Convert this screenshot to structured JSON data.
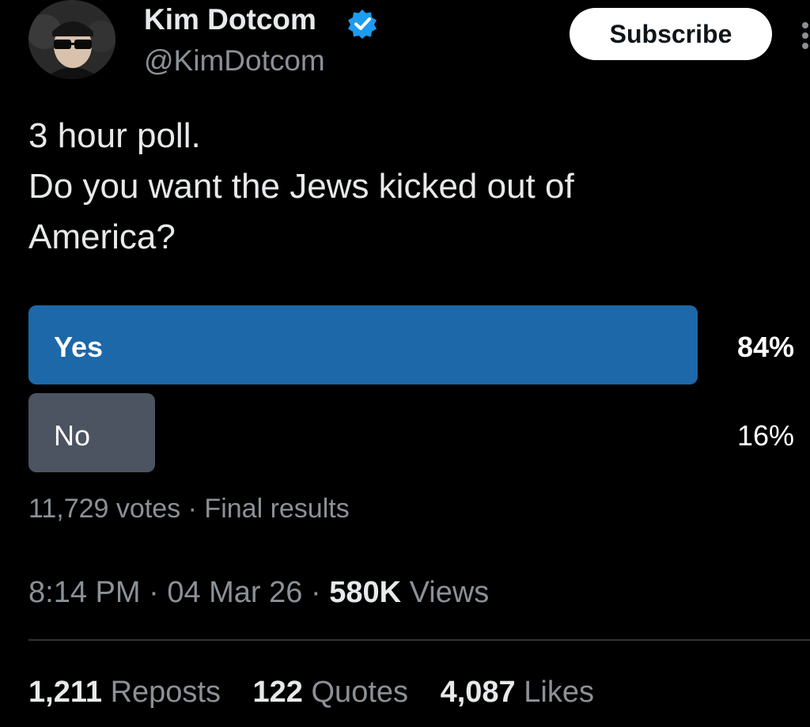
{
  "author": {
    "name": "Kim Dotcom",
    "handle": "@KimDotcom",
    "verified": true
  },
  "subscribe_label": "Subscribe",
  "tweet": {
    "lines": [
      "3 hour poll.",
      "Do you want the Jews kicked out of",
      "America?"
    ]
  },
  "poll": {
    "options": [
      {
        "label": "Yes",
        "percent_text": "84%",
        "percent": 84,
        "leading": true
      },
      {
        "label": "No",
        "percent_text": "16%",
        "percent": 16,
        "leading": false
      }
    ],
    "votes": "11,729 votes",
    "separator": "·",
    "status": "Final results"
  },
  "meta": {
    "time": "8:14 PM",
    "separator": "·",
    "date": "04 Mar 26",
    "views_count": "580K",
    "views_label": "Views"
  },
  "stats": {
    "reposts_count": "1,211",
    "reposts_label": "Reposts",
    "quotes_count": "122",
    "quotes_label": "Quotes",
    "likes_count": "4,087",
    "likes_label": "Likes"
  },
  "colors": {
    "background": "#000000",
    "text": "#e7e9ea",
    "secondary_text": "#8b9196",
    "poll_leading": "#1d68a8",
    "poll_other": "#4b5460",
    "verified": "#1d9bf0"
  },
  "icons": {
    "verified": "verified-badge-icon",
    "more": "more-vertical-icon"
  }
}
